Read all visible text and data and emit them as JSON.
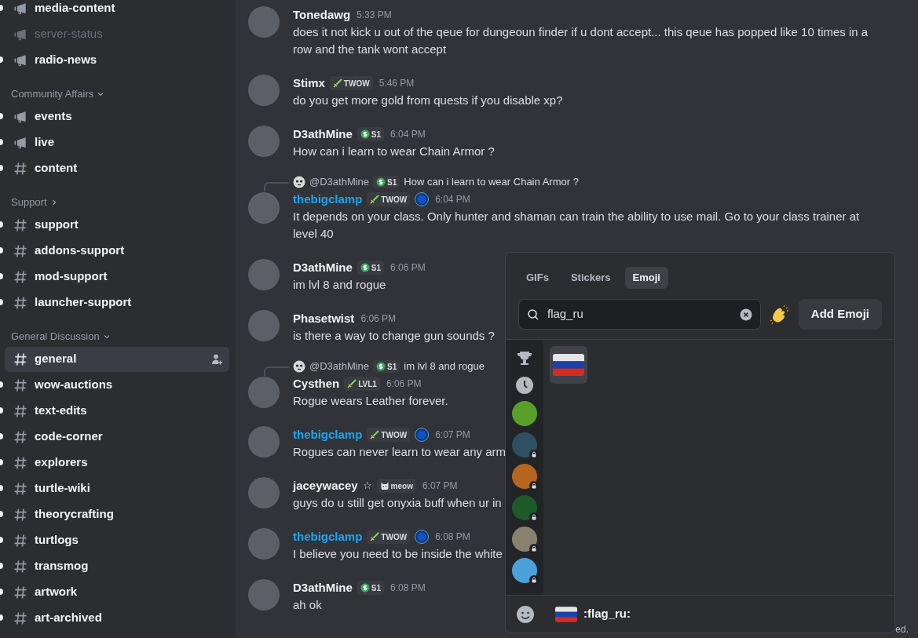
{
  "sidebar": {
    "sections": [
      {
        "kind": "channels",
        "channels": [
          {
            "name": "media-content",
            "kind": "announcement",
            "unread": true,
            "muted": false,
            "selected": false
          },
          {
            "name": "server-status",
            "kind": "announcement",
            "unread": false,
            "muted": true,
            "selected": false
          },
          {
            "name": "radio-news",
            "kind": "announcement",
            "unread": true,
            "muted": false,
            "selected": false
          }
        ]
      },
      {
        "kind": "category",
        "title": "Community Affairs",
        "expanded": true,
        "channels": [
          {
            "name": "events",
            "kind": "announcement",
            "unread": true,
            "muted": false,
            "selected": false
          },
          {
            "name": "live",
            "kind": "announcement",
            "unread": true,
            "muted": false,
            "selected": false
          },
          {
            "name": "content",
            "kind": "text",
            "unread": true,
            "muted": false,
            "selected": false
          }
        ]
      },
      {
        "kind": "category",
        "title": "Support",
        "expanded": false,
        "channels": [
          {
            "name": "support",
            "kind": "text",
            "unread": true,
            "muted": false,
            "selected": false
          },
          {
            "name": "addons-support",
            "kind": "text",
            "unread": true,
            "muted": false,
            "selected": false
          },
          {
            "name": "mod-support",
            "kind": "text",
            "unread": true,
            "muted": false,
            "selected": false
          },
          {
            "name": "launcher-support",
            "kind": "text",
            "unread": true,
            "muted": false,
            "selected": false
          }
        ]
      },
      {
        "kind": "category",
        "title": "General Discussion",
        "expanded": true,
        "channels": [
          {
            "name": "general",
            "kind": "text",
            "unread": false,
            "muted": false,
            "selected": true
          },
          {
            "name": "wow-auctions",
            "kind": "text",
            "unread": true,
            "muted": false,
            "selected": false
          },
          {
            "name": "text-edits",
            "kind": "text",
            "unread": true,
            "muted": false,
            "selected": false
          },
          {
            "name": "code-corner",
            "kind": "text",
            "unread": true,
            "muted": false,
            "selected": false
          },
          {
            "name": "explorers",
            "kind": "text",
            "unread": true,
            "muted": false,
            "selected": false
          },
          {
            "name": "turtle-wiki",
            "kind": "text",
            "unread": true,
            "muted": false,
            "selected": false
          },
          {
            "name": "theorycrafting",
            "kind": "text",
            "unread": true,
            "muted": false,
            "selected": false
          },
          {
            "name": "turtlogs",
            "kind": "text",
            "unread": true,
            "muted": false,
            "selected": false
          },
          {
            "name": "transmog",
            "kind": "text",
            "unread": true,
            "muted": false,
            "selected": false
          },
          {
            "name": "artwork",
            "kind": "text",
            "unread": true,
            "muted": false,
            "selected": false
          },
          {
            "name": "art-archived",
            "kind": "text",
            "unread": true,
            "muted": false,
            "selected": false
          }
        ]
      }
    ]
  },
  "messages": [
    {
      "author": "Tonedawg",
      "color": "#f2f3f5",
      "time": "5:33 PM",
      "text": "does it not kick u out of the qeue for dungeoun finder if u dont accept... this qeue has popped like 10 times in a row and the tank wont accept"
    },
    {
      "author": "Stimx",
      "color": "#f2f3f5",
      "badge": {
        "kind": "sword",
        "label": "TWOW"
      },
      "time": "5:46 PM",
      "text": "do you get more gold from quests if you disable xp?"
    },
    {
      "author": "D3athMine",
      "color": "#f2f3f5",
      "badge": {
        "kind": "dollar",
        "label": "S1"
      },
      "time": "6:04 PM",
      "text": "How can i learn to wear Chain Armor ?"
    },
    {
      "reply": {
        "author": "@D3athMine",
        "badge": {
          "kind": "dollar",
          "label": "S1"
        },
        "text": "How can i learn to wear Chain Armor ?"
      },
      "author": "thebigclamp",
      "color": "#1ea5f0",
      "badge": {
        "kind": "sword",
        "label": "TWOW"
      },
      "orb": true,
      "time": "6:04 PM",
      "text": "It depends on your class. Only hunter and shaman can train the ability to use mail. Go to your class trainer at level 40"
    },
    {
      "author": "D3athMine",
      "color": "#f2f3f5",
      "badge": {
        "kind": "dollar",
        "label": "S1"
      },
      "time": "6:06 PM",
      "text": "im lvl 8 and rogue"
    },
    {
      "author": "Phasetwist",
      "color": "#f2f3f5",
      "time": "6:06 PM",
      "text": "is there a way to change gun sounds ?"
    },
    {
      "reply": {
        "author": "@D3athMine",
        "badge": {
          "kind": "dollar",
          "label": "S1"
        },
        "text": "im lvl 8 and rogue"
      },
      "author": "Cysthen",
      "color": "#f2f3f5",
      "badge": {
        "kind": "sword",
        "label": "LVL1"
      },
      "time": "6:06 PM",
      "text": "Rogue wears Leather forever."
    },
    {
      "author": "thebigclamp",
      "color": "#1ea5f0",
      "badge": {
        "kind": "sword",
        "label": "TWOW"
      },
      "orb": true,
      "time": "6:07 PM",
      "text": "Rogues can never learn to wear any arm"
    },
    {
      "author": "jaceywacey",
      "author_mark": "☆",
      "color": "#f2f3f5",
      "badge": {
        "kind": "cat",
        "label": "meow"
      },
      "time": "6:07 PM",
      "text": "guys do u still get onyxia buff when ur in"
    },
    {
      "author": "thebigclamp",
      "color": "#1ea5f0",
      "badge": {
        "kind": "sword",
        "label": "TWOW"
      },
      "orb": true,
      "time": "6:08 PM",
      "text": "I believe you need to be inside the white"
    },
    {
      "author": "D3athMine",
      "color": "#f2f3f5",
      "badge": {
        "kind": "dollar",
        "label": "S1"
      },
      "time": "6:08 PM",
      "text": "ah ok"
    }
  ],
  "footer_fragment": "ed.",
  "emoji_picker": {
    "tabs": [
      {
        "label": "GIFs",
        "selected": false
      },
      {
        "label": "Stickers",
        "selected": false
      },
      {
        "label": "Emoji",
        "selected": true
      }
    ],
    "search": {
      "value": "flag_ru"
    },
    "add_button": "Add Emoji",
    "categories": [
      {
        "kind": "trophy"
      },
      {
        "kind": "clock"
      },
      {
        "kind": "server",
        "locked": false,
        "color": "#5a9e2a"
      },
      {
        "kind": "server",
        "locked": true,
        "color": "#2f4f63"
      },
      {
        "kind": "server",
        "locked": true,
        "color": "#b5651d"
      },
      {
        "kind": "server",
        "locked": true,
        "color": "#1f5a2a"
      },
      {
        "kind": "server",
        "locked": true,
        "color": "#8a8070"
      },
      {
        "kind": "server",
        "locked": true,
        "color": "#4aa0d8"
      }
    ],
    "results": [
      {
        "kind": "flag_ru",
        "selected": true
      }
    ],
    "preview": {
      "name": ":flag_ru:"
    }
  }
}
